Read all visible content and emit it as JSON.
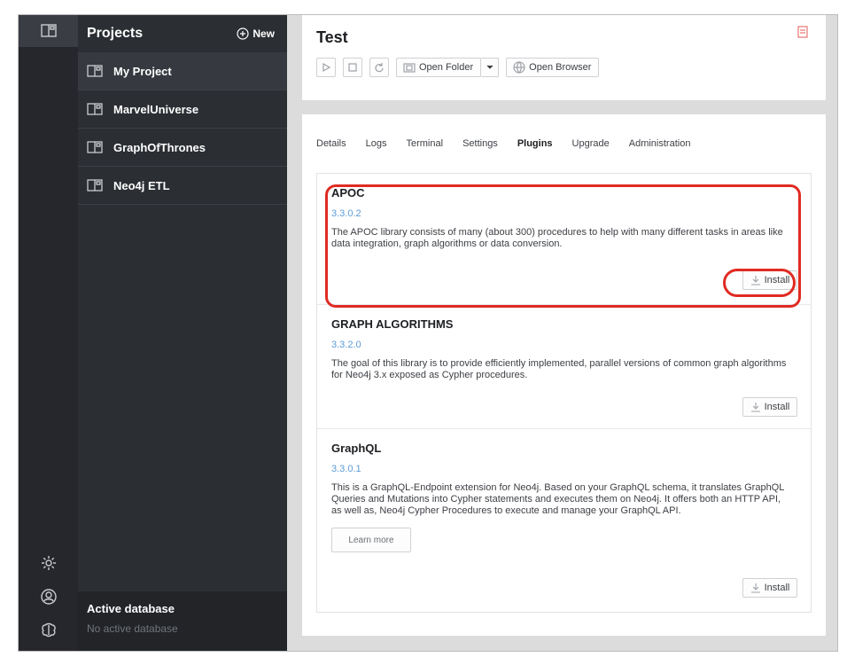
{
  "sidebar": {
    "title": "Projects",
    "new_label": "New",
    "projects": [
      {
        "label": "My Project"
      },
      {
        "label": "MarvelUniverse"
      },
      {
        "label": "GraphOfThrones"
      },
      {
        "label": "Neo4j ETL"
      }
    ],
    "active_db_title": "Active database",
    "active_db_value": "No active database"
  },
  "rail": {
    "icons": [
      "projects-icon",
      "settings-gear-icon",
      "user-icon",
      "brain-icon"
    ]
  },
  "project": {
    "name": "Test",
    "open_folder_label": "Open Folder",
    "open_browser_label": "Open Browser"
  },
  "tabs": [
    {
      "label": "Details"
    },
    {
      "label": "Logs"
    },
    {
      "label": "Terminal"
    },
    {
      "label": "Settings"
    },
    {
      "label": "Plugins"
    },
    {
      "label": "Upgrade"
    },
    {
      "label": "Administration"
    }
  ],
  "active_tab": "Plugins",
  "plugins": [
    {
      "name": "APOC",
      "version": "3.3.0.2",
      "description": "The APOC library consists of many (about 300) procedures to help with many different tasks in areas like data integration, graph algorithms or data conversion.",
      "install_label": "Install"
    },
    {
      "name": "GRAPH ALGORITHMS",
      "version": "3.3.2.0",
      "description": "The goal of this library is to provide efficiently implemented, parallel versions of common graph algorithms for Neo4j 3.x exposed as Cypher procedures.",
      "install_label": "Install"
    },
    {
      "name": "GraphQL",
      "version": "3.3.0.1",
      "description": "This is a GraphQL-Endpoint extension for Neo4j. Based on your GraphQL schema, it translates GraphQL Queries and Mutations into Cypher statements and executes them on Neo4j. It offers both an HTTP API, as well as, Neo4j Cypher Procedures to execute and manage your GraphQL API.",
      "learn_more_label": "Learn more",
      "install_label": "Install"
    }
  ],
  "colors": {
    "highlight": "#e02b22",
    "version": "#5b9bd6",
    "rail_bg": "#25272c",
    "panel_bg": "#2b2e33"
  }
}
